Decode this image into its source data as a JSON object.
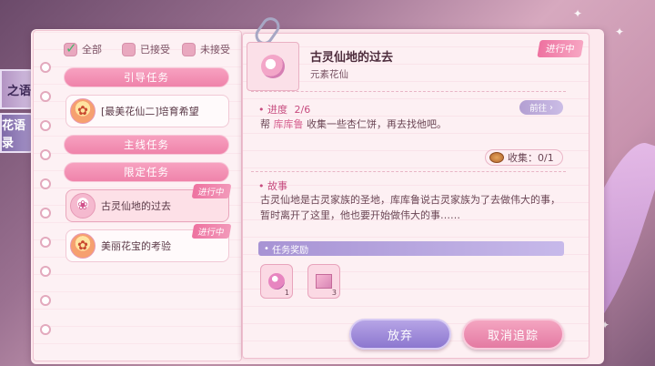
{
  "side_tabs": [
    {
      "label": "之语",
      "active": false
    },
    {
      "label": "花语录",
      "active": true
    }
  ],
  "filters": [
    {
      "label": "全部",
      "checked": true
    },
    {
      "label": "已接受",
      "checked": false
    },
    {
      "label": "未接受",
      "checked": false
    }
  ],
  "categories": {
    "guide": "引导任务",
    "main": "主线任务",
    "limited": "限定任务"
  },
  "quests": {
    "guide_item": "[最美花仙二]培育希望",
    "limited_items": [
      {
        "label": "古灵仙地的过去",
        "status": "进行中",
        "selected": true
      },
      {
        "label": "美丽花宝的考验",
        "status": "进行中",
        "selected": false
      }
    ]
  },
  "detail": {
    "status": "进行中",
    "title": "古灵仙地的过去",
    "subtitle": "元素花仙",
    "progress_label": "进度",
    "progress_value": "2/6",
    "goto_label": "前往",
    "task_prefix": "帮",
    "task_npc": "库库鲁",
    "task_rest": "收集一些杏仁饼，再去找他吧。",
    "collect_label": "收集：0/1",
    "story_label": "故事",
    "story_text": "古灵仙地是古灵家族的圣地，库库鲁说古灵家族为了去做伟大的事，暂时离开了这里，他也要开始做伟大的事……",
    "reward_label": "任务奖励",
    "rewards": [
      {
        "icon": "gem-icon",
        "count": "1"
      },
      {
        "icon": "gift-box-icon",
        "count": "3"
      }
    ],
    "give_up": "放弃",
    "untrack": "取消追踪"
  }
}
